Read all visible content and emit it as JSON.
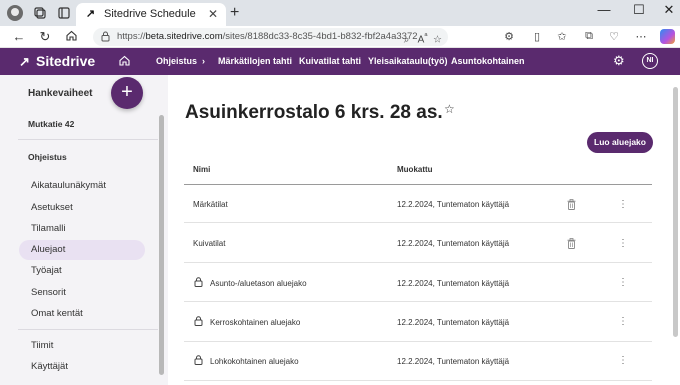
{
  "browser": {
    "tab_title": "Sitedrive Schedule",
    "tab_favicon": "↗",
    "url_prefix": "https://",
    "url_host": "beta.sitedrive.com",
    "url_rest": "/sites/8188dc33-8c35-4bd1-b832-fbf2a4a3372a/proj...",
    "min_glyph": "—",
    "max_glyph": "☐",
    "close_glyph": "✕"
  },
  "header": {
    "logo_text": "Sitedrive",
    "brand_color": "#5a2a6e",
    "nav": [
      {
        "label": "Ohjeistus",
        "chevron": "›"
      },
      {
        "label": "Märkätilojen tahti"
      },
      {
        "label": "Kuivatilat tahti"
      },
      {
        "label": "Yleisaikataulu(työ)"
      },
      {
        "label": "Asuntokohtainen"
      }
    ],
    "user_initials": "NI"
  },
  "sidebar": {
    "project": "Hankevaiheet",
    "add_symbol": "+",
    "milestone": "Mutkatie 42",
    "section": "Ohjeistus",
    "items": [
      {
        "label": "Aikataulunäkymät"
      },
      {
        "label": "Asetukset"
      },
      {
        "label": "Tilamalli"
      },
      {
        "label": "Aluejaot"
      },
      {
        "label": "Työajat"
      },
      {
        "label": "Sensorit"
      },
      {
        "label": "Omat kentät"
      }
    ],
    "bottom_items": [
      {
        "label": "Tiimit"
      },
      {
        "label": "Käyttäjät"
      }
    ]
  },
  "main": {
    "title": "Asuinkerrostalo 6 krs. 28 as.",
    "star": "☆",
    "create_button": "Luo aluejako",
    "columns": {
      "name": "Nimi",
      "modified": "Muokattu"
    },
    "rows": [
      {
        "name": "Märkätilat",
        "modified": "12.2.2024, Tuntematon käyttäjä",
        "locked": false,
        "deletable": true
      },
      {
        "name": "Kuivatilat",
        "modified": "12.2.2024, Tuntematon käyttäjä",
        "locked": false,
        "deletable": true
      },
      {
        "name": "Asunto-/aluetason aluejako",
        "modified": "12.2.2024, Tuntematon käyttäjä",
        "locked": true,
        "deletable": false
      },
      {
        "name": "Kerroskohtainen aluejako",
        "modified": "12.2.2024, Tuntematon käyttäjä",
        "locked": true,
        "deletable": false
      },
      {
        "name": "Lohkokohtainen aluejako",
        "modified": "12.2.2024, Tuntematon käyttäjä",
        "locked": true,
        "deletable": false
      }
    ],
    "more_glyph": "⋮"
  }
}
